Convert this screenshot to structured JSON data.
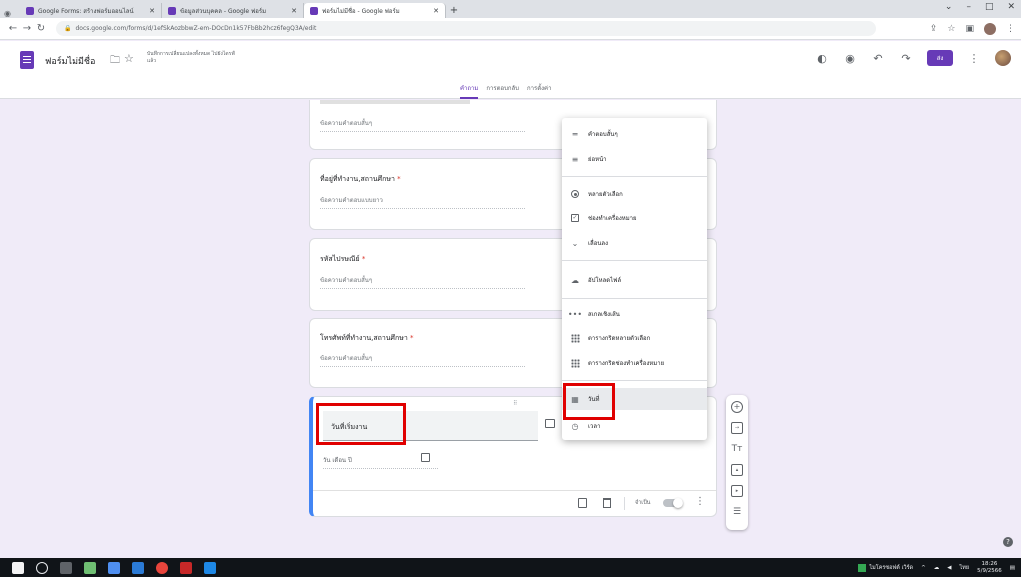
{
  "browser": {
    "tabs": [
      {
        "label": "Google Forms: สร้างฟอร์มออนไลน์",
        "favicon_color": "#673ab7",
        "active": false
      },
      {
        "label": "ข้อมูลส่วนบุคคล - Google ฟอร์ม",
        "favicon_color": "#673ab7",
        "active": false
      },
      {
        "label": "ฟอร์มไม่มีชื่อ - Google ฟอร์ม",
        "favicon_color": "#673ab7",
        "active": true
      }
    ],
    "new_tab": "+",
    "address": "docs.google.com/forms/d/1efSkAozbbwZ-em-DOcDn1k57FbBb2hcz6fegQ3A/edit",
    "window_controls": [
      "⌄",
      "–",
      "□",
      "✕"
    ]
  },
  "form_header": {
    "title": "ฟอร์มไม่มีชื่อ",
    "save_status": "บันทึกการเปลี่ยนแปลงทั้งหมด ไปยังไดรฟ์แล้ว",
    "send_label": "ส่ง",
    "tabs": [
      "คำถาม",
      "การตอบกลับ",
      "การตั้งค่า"
    ]
  },
  "questions": [
    {
      "title": "",
      "answer_hint": "ข้อความคำตอบสั้นๆ"
    },
    {
      "title": "ที่อยู่ที่ทำงาน,สถานศึกษา",
      "required": "*",
      "answer_hint": "ข้อความคำตอบแบบยาว"
    },
    {
      "title": "รหัสไปรษณีย์",
      "required": "*",
      "answer_hint": "ข้อความคำตอบสั้นๆ"
    },
    {
      "title": "โทรศัพท์ที่ทำงาน,สถานศึกษา",
      "required": "*",
      "answer_hint": "ข้อความคำตอบสั้นๆ"
    }
  ],
  "active_question": {
    "title": "วันที่เริ่มงาน",
    "date_hint": "วัน เดือน ปี",
    "required_label": "จำเป็น",
    "drag_handle": "⠿"
  },
  "type_menu": {
    "items": [
      {
        "label": "คำตอบสั้นๆ",
        "icon": "short-answer-icon"
      },
      {
        "label": "ย่อหน้า",
        "icon": "paragraph-icon"
      },
      {
        "label": "หลายตัวเลือก",
        "icon": "radio-icon"
      },
      {
        "label": "ช่องทำเครื่องหมาย",
        "icon": "checkbox-icon"
      },
      {
        "label": "เลื่อนลง",
        "icon": "dropdown-icon"
      },
      {
        "label": "อัปโหลดไฟล์",
        "icon": "upload-icon"
      },
      {
        "label": "สเกลเชิงเส้น",
        "icon": "linear-scale-icon"
      },
      {
        "label": "ตารางกริดหลายตัวเลือก",
        "icon": "grid-icon"
      },
      {
        "label": "ตารางกริดช่องทำเครื่องหมาย",
        "icon": "grid-icon"
      },
      {
        "label": "วันที่",
        "icon": "calendar-icon"
      },
      {
        "label": "เวลา",
        "icon": "clock-icon"
      }
    ]
  },
  "taskbar": {
    "app_label": "ไมโครซอฟต์ เวิร์ด",
    "lang": "ไทย",
    "time": "18:26",
    "date": "5/9/2566"
  },
  "colors": {
    "accent": "#673ab7",
    "highlight": "#e00000",
    "active_border": "#4285f4"
  }
}
